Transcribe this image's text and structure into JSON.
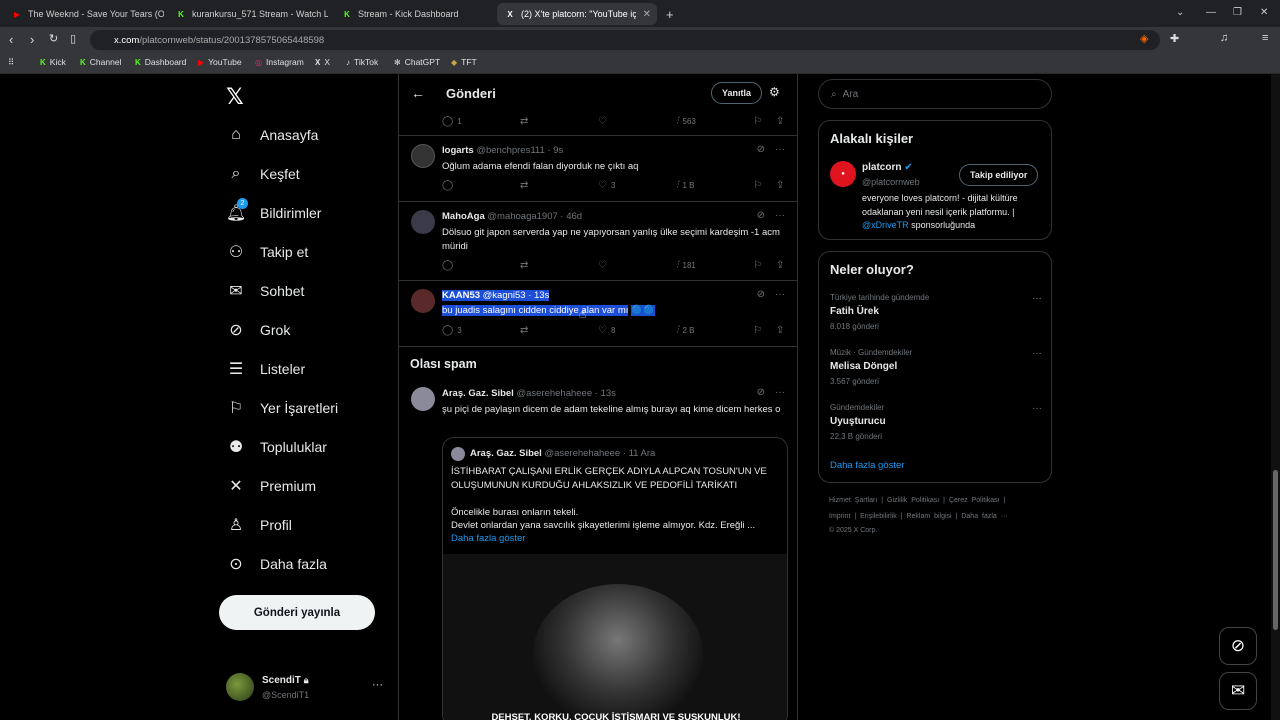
{
  "tabs": [
    {
      "title": "The Weeknd - Save Your Tears (Offici",
      "fav": "▶",
      "favcolor": "#ff0000"
    },
    {
      "title": "kurankursu_571 Stream - Watch Live",
      "fav": "K",
      "favcolor": "#53fc18"
    },
    {
      "title": "Stream - Kick Dashboard",
      "fav": "K",
      "favcolor": "#53fc18"
    },
    {
      "title": "(2) X'te platcorn: \"YouTube içeriği",
      "fav": "X",
      "favcolor": "#ffffff"
    }
  ],
  "url": {
    "host": "x.com",
    "path": "/platcornweb/status/2001378575065448598"
  },
  "bookmarks": [
    {
      "label": "Kick",
      "icon": "K"
    },
    {
      "label": "Channel",
      "icon": "K"
    },
    {
      "label": "Dashboard",
      "icon": "K"
    },
    {
      "label": "YouTube",
      "icon": "▶"
    },
    {
      "label": "Instagram",
      "icon": "◎"
    },
    {
      "label": "X",
      "icon": "X"
    },
    {
      "label": "TikTok",
      "icon": "♪"
    },
    {
      "label": "ChatGPT",
      "icon": "✻"
    },
    {
      "label": "TFT",
      "icon": "◆"
    }
  ],
  "nav": [
    {
      "label": "Anasayfa",
      "icon": "home-icon"
    },
    {
      "label": "Keşfet",
      "icon": "search-icon"
    },
    {
      "label": "Bildirimler",
      "icon": "bell-icon",
      "badge": "2"
    },
    {
      "label": "Takip et",
      "icon": "follow-icon"
    },
    {
      "label": "Sohbet",
      "icon": "mail-icon"
    },
    {
      "label": "Grok",
      "icon": "grok-icon"
    },
    {
      "label": "Listeler",
      "icon": "list-icon"
    },
    {
      "label": "Yer İşaretleri",
      "icon": "bookmark-icon"
    },
    {
      "label": "Topluluklar",
      "icon": "communities-icon"
    },
    {
      "label": "Premium",
      "icon": "x-icon"
    },
    {
      "label": "Profil",
      "icon": "profile-icon"
    },
    {
      "label": "Daha fazla",
      "icon": "more-icon"
    }
  ],
  "post_button": "Gönderi yayınla",
  "account": {
    "name": "ScendiT",
    "handle": "@ScendiT1"
  },
  "header": {
    "title": "Gönderi",
    "reply_button": "Yanıtla"
  },
  "top_actions": {
    "replies": "1",
    "views": "563"
  },
  "tweets": [
    {
      "name": "logarts",
      "handle": "@benchpres111 · 9s",
      "text": "Oğlum adama efendi falan diyorduk ne çıktı aq",
      "replies": "",
      "retweets": "",
      "likes": "3",
      "views": "1 B"
    },
    {
      "name": "MahoAga",
      "handle": "@mahoaga1907 · 46d",
      "text": "Dölsuo git japon serverda yap ne yapıyorsan yanlış ülke seçimi kardeşim -1 acm müridi",
      "replies": "",
      "retweets": "",
      "likes": "",
      "views": "181"
    },
    {
      "name": "KAAN53",
      "handle": "@kagni53 · 13s",
      "text": "bu juadis salagını cidden ciddiye alan var mı",
      "replies": "3",
      "retweets": "",
      "likes": "8",
      "views": "2 B"
    }
  ],
  "spam_heading": "Olası spam",
  "spam_tweet": {
    "name": "Araş. Gaz. Sibel",
    "handle": "@aserehehaheee · 13s",
    "text": "şu piçi de paylaşın dicem de adam tekeline almış burayı aq kime dicem herkes o",
    "quote": {
      "name": "Araş. Gaz. Sibel",
      "handle": "@aserehehaheee · 11 Ara",
      "text1": "İSTİHBARAT ÇALIŞANI ERLİK GERÇEK ADIYLA ALPCAN TOSUN'UN VE OLUŞUMUNUN KURDUĞU AHLAKSIZLIK VE PEDOFİLİ TARİKATI",
      "text2": "Öncelikle burası onların tekeli.",
      "text3": "Devlet onlardan yana savcılık şikayetlerimi işleme almıyor. Kdz. Ereğli ...",
      "show_more": "Daha fazla göster",
      "caption": "DEHŞET, KORKU, ÇOCUK İSTİSMARI VE SUSKUNLUK!"
    }
  },
  "search": {
    "placeholder": "Ara"
  },
  "related": {
    "heading": "Alakalı kişiler",
    "name": "platcorn",
    "handle": "@platcornweb",
    "follow": "Takip ediliyor",
    "bio": "everyone loves platcorn! - dijital kültüre odaklanan yeni nesil içerik platformu. |",
    "bio_link": "@xDriveTR",
    "bio_tail": " sponsorluğunda"
  },
  "trends": {
    "heading": "Neler oluyor?",
    "items": [
      {
        "cat": "Türkiye tarihinde gündemde",
        "title": "Fatih Ürek",
        "count": "8.018 gönderi"
      },
      {
        "cat": "Müzik · Gündemdekiler",
        "title": "Melisa Döngel",
        "count": "3.567 gönderi"
      },
      {
        "cat": "Gündemdekiler",
        "title": "Uyuşturucu",
        "count": "22,3 B gönderi"
      }
    ],
    "show_more": "Daha fazla göster"
  },
  "footer": {
    "l1": [
      "Hizmet Şartları",
      "|",
      "Gizlilik Politikası",
      "|",
      "Çerez Politikası",
      "|"
    ],
    "l2": [
      "Imprint",
      "|",
      "Erişilebilirlik",
      "|",
      "Reklam bilgisi",
      "|",
      "Daha fazla ···"
    ],
    "copy": "© 2025 X Corp."
  }
}
